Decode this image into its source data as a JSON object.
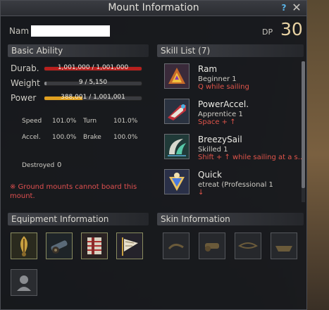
{
  "window": {
    "title": "Mount Information",
    "help_label": "?",
    "close_label": "✕"
  },
  "header": {
    "name_label": "Nam",
    "name_value": "",
    "dp_label": "DP",
    "dp_value": "30"
  },
  "basic_ability": {
    "heading": "Basic Ability",
    "stats": [
      {
        "label": "Durab.",
        "text": "1,001,000 / 1,001,000",
        "fill": 1.0,
        "color": "#b8201e"
      },
      {
        "label": "Weight",
        "text": "9 / 5,150",
        "fill": 0.002,
        "color": "#8a8c90"
      },
      {
        "label": "Power",
        "text": "388,001 / 1,001,001",
        "fill": 0.388,
        "color": "#e0a020"
      }
    ],
    "speed_label": "Speed",
    "speed_value": "101.0%",
    "turn_label": "Turn",
    "turn_value": "101.0%",
    "accel_label": "Accel.",
    "accel_value": "100.0%",
    "brake_label": "Brake",
    "brake_value": "100.0%",
    "destroyed_label": "Destroyed",
    "destroyed_value": "0",
    "notice": "※ Ground mounts cannot board this mount."
  },
  "skill_list": {
    "heading": "Skill List (7)",
    "skills": [
      {
        "name": "Ram",
        "level": "Beginner 1",
        "command": "Q while sailing",
        "icon": "ram-icon"
      },
      {
        "name": "PowerAccel.",
        "level": "Apprentice 1",
        "command": "Space + ↑",
        "icon": "power-accel-icon"
      },
      {
        "name": "BreezySail",
        "level": "Skilled 1",
        "command": "Shift + ↑ while sailing at a s...",
        "icon": "breezy-sail-icon"
      },
      {
        "name": "Quick",
        "level": "etreat (Professional 1",
        "command": "↓",
        "icon": "quick-icon"
      }
    ]
  },
  "equipment": {
    "heading": "Equipment Information",
    "slots": [
      "figurehead-icon",
      "cannon-icon",
      "plating-icon",
      "sail-icon",
      "sailor-icon"
    ]
  },
  "skin": {
    "heading": "Skin Information",
    "slots": [
      "skin-figurehead-icon",
      "skin-cannon-icon",
      "skin-wind-icon",
      "skin-hull-icon"
    ]
  }
}
